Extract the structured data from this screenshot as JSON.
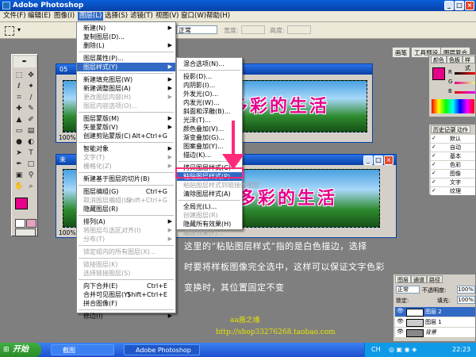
{
  "app": {
    "title": "Adobe Photoshop",
    "colors": {
      "titlebar": "#0840a8",
      "menu_highlight": "#316ac5",
      "foreground": "#e6008a",
      "background": "#e6008a",
      "annotation_border": "#ff2a7a"
    }
  },
  "menubar": {
    "items": [
      "文件(F)",
      "编辑(E)",
      "图像(I)",
      "图层(L)",
      "选择(S)",
      "滤镜(T)",
      "视图(V)",
      "窗口(W)",
      "帮助(H)"
    ]
  },
  "options": {
    "style_value": "正常",
    "width_label": "宽度:",
    "height_label": "高度:"
  },
  "palette_well": [
    "画笔",
    "工具预设",
    "图层复合"
  ],
  "toolbox": {
    "icons": [
      "marquee-icon",
      "move-icon",
      "lasso-icon",
      "magic-wand-icon",
      "crop-icon",
      "slice-icon",
      "healing-icon",
      "brush-icon",
      "stamp-icon",
      "history-brush-icon",
      "eraser-icon",
      "gradient-icon",
      "blur-icon",
      "dodge-icon",
      "path-select-icon",
      "type-icon",
      "pen-icon",
      "shape-icon",
      "notes-icon",
      "eyedropper-icon",
      "hand-icon",
      "zoom-icon"
    ]
  },
  "doc1": {
    "title": "05",
    "banner": "多彩的生活",
    "zoom": "100%"
  },
  "doc2": {
    "title": "未",
    "banner": "多彩的生活",
    "zoom": "100%"
  },
  "layer_menu": {
    "items": [
      {
        "label": "新建(N)",
        "sc": "",
        "sub": true,
        "disabled": false
      },
      {
        "label": "复制图层(D)...",
        "sc": "",
        "sub": false,
        "disabled": false
      },
      {
        "label": "删除(L)",
        "sc": "",
        "sub": true,
        "disabled": false
      },
      {
        "sep": true
      },
      {
        "label": "图层属性(P)...",
        "sc": "",
        "sub": false,
        "disabled": false
      },
      {
        "label": "图层样式(Y)",
        "sc": "",
        "sub": true,
        "disabled": false,
        "hl": true
      },
      {
        "sep": true
      },
      {
        "label": "新建填充图层(W)",
        "sc": "",
        "sub": true,
        "disabled": false
      },
      {
        "label": "新建调整图层(A)",
        "sc": "",
        "sub": true,
        "disabled": false
      },
      {
        "label": "更改图层内容(H)",
        "sc": "",
        "sub": true,
        "disabled": true
      },
      {
        "label": "图层内容选项(O)...",
        "sc": "",
        "sub": false,
        "disabled": true
      },
      {
        "sep": true
      },
      {
        "label": "图层蒙版(M)",
        "sc": "",
        "sub": true,
        "disabled": false
      },
      {
        "label": "矢量蒙版(V)",
        "sc": "",
        "sub": true,
        "disabled": false
      },
      {
        "label": "创建剪贴蒙版(C)",
        "sc": "Alt+Ctrl+G",
        "sub": false,
        "disabled": false
      },
      {
        "sep": true
      },
      {
        "label": "智能对象",
        "sc": "",
        "sub": true,
        "disabled": false
      },
      {
        "label": "文字(T)",
        "sc": "",
        "sub": true,
        "disabled": true
      },
      {
        "label": "栅格化(Z)",
        "sc": "",
        "sub": true,
        "disabled": true
      },
      {
        "sep": true
      },
      {
        "label": "新建基于图层的切片(B)",
        "sc": "",
        "sub": false,
        "disabled": false
      },
      {
        "sep": true
      },
      {
        "label": "图层编组(G)",
        "sc": "Ctrl+G",
        "sub": false,
        "disabled": false
      },
      {
        "label": "取消图层编组(U)",
        "sc": "Shift+Ctrl+G",
        "sub": false,
        "disabled": true
      },
      {
        "label": "隐藏图层(R)",
        "sc": "",
        "sub": false,
        "disabled": false
      },
      {
        "sep": true
      },
      {
        "label": "排列(A)",
        "sc": "",
        "sub": true,
        "disabled": false
      },
      {
        "label": "将图层与选区对齐(I)",
        "sc": "",
        "sub": true,
        "disabled": true
      },
      {
        "label": "分布(T)",
        "sc": "",
        "sub": true,
        "disabled": true
      },
      {
        "sep": true
      },
      {
        "label": "锁定组内的所有图层(X)...",
        "sc": "",
        "sub": false,
        "disabled": true
      },
      {
        "sep": true
      },
      {
        "label": "链接图层(K)",
        "sc": "",
        "sub": false,
        "disabled": true
      },
      {
        "label": "选择链接图层(S)",
        "sc": "",
        "sub": false,
        "disabled": true
      },
      {
        "sep": true
      },
      {
        "label": "向下合并(E)",
        "sc": "Ctrl+E",
        "sub": false,
        "disabled": false
      },
      {
        "label": "合并可见图层(Y)",
        "sc": "Shift+Ctrl+E",
        "sub": false,
        "disabled": false
      },
      {
        "label": "拼合图像(F)",
        "sc": "",
        "sub": false,
        "disabled": false
      },
      {
        "sep": true
      },
      {
        "label": "修边(I)",
        "sc": "",
        "sub": true,
        "disabled": false
      }
    ]
  },
  "style_submenu": {
    "items": [
      {
        "label": "混合选项(N)...",
        "disabled": false
      },
      {
        "sep": true
      },
      {
        "label": "投影(D)...",
        "disabled": false
      },
      {
        "label": "内阴影(I)...",
        "disabled": false
      },
      {
        "label": "外发光(O)...",
        "disabled": false
      },
      {
        "label": "内发光(W)...",
        "disabled": false
      },
      {
        "label": "斜面和浮雕(B)...",
        "disabled": false
      },
      {
        "label": "光泽(T)...",
        "disabled": false
      },
      {
        "label": "颜色叠加(V)...",
        "disabled": false
      },
      {
        "label": "渐变叠加(G)...",
        "disabled": false
      },
      {
        "label": "图案叠加(Y)...",
        "disabled": false
      },
      {
        "label": "描边(K)...",
        "disabled": false
      },
      {
        "sep": true
      },
      {
        "label": "拷贝图层样式(C)",
        "disabled": false
      },
      {
        "label": "粘贴图层样式(P)",
        "disabled": false,
        "hl": true
      },
      {
        "label": "粘贴图层样式到链接的图层",
        "disabled": true
      },
      {
        "label": "清除图层样式(A)",
        "disabled": false
      },
      {
        "sep": true
      },
      {
        "label": "全局光(L)...",
        "disabled": false
      },
      {
        "label": "创建图层(R)",
        "disabled": true
      },
      {
        "label": "隐藏所有效果(H)",
        "disabled": false
      },
      {
        "label": "缩放效果(F)...",
        "disabled": true
      }
    ]
  },
  "color_panel": {
    "tabs": [
      "颜色",
      "色板",
      "样式"
    ],
    "channels": [
      "R",
      "G",
      "B"
    ]
  },
  "history_panel": {
    "tabs": [
      "历史记录",
      "动作"
    ],
    "rows": [
      "默认",
      "自动",
      "基本",
      "色彩",
      "图像",
      "文字",
      "纹理"
    ]
  },
  "layers_panel": {
    "tabs": [
      "图层",
      "通道",
      "路径"
    ],
    "blend_mode": "正常",
    "opacity_label": "不透明度:",
    "opacity_value": "100%",
    "lock_label": "锁定:",
    "fill_label": "填充:",
    "fill_value": "100%",
    "layers": [
      "图层 2",
      "图层 1",
      "背景"
    ]
  },
  "annotation": {
    "lines": [
      "这里的“粘贴图层样式”指的是白色描边，选择",
      "时要将样板图像完全选中，这样可以保证文字色彩",
      "变换时，其位置固定不变"
    ],
    "signature": "aa画之缘",
    "url": "http://shop33276268.taobao.com"
  },
  "taskbar": {
    "start": "开始",
    "tasks": [
      "截图",
      "Adobe Photoshop"
    ],
    "lang": "CH",
    "clock": "22:23"
  }
}
